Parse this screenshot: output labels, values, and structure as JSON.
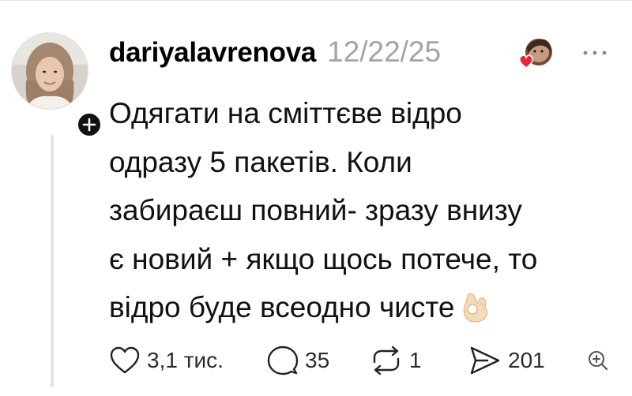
{
  "post": {
    "username": "dariyalavrenova",
    "timestamp": "12/22/25",
    "text_lines": [
      "Одягати на сміттєве відро",
      "одразу 5 пакетів. Коли",
      "забираєш повний- зразу внизу",
      "є новий + якщо щось потече, то",
      "відро буде всеодно чисте"
    ],
    "emoji": "ok-hand"
  },
  "actions": {
    "likes": "3,1 тис.",
    "comments": "35",
    "reposts": "1",
    "shares": "201"
  },
  "icons": {
    "like": "heart-icon",
    "comment": "comment-bubble-icon",
    "repost": "repost-icon",
    "share": "send-icon",
    "more": "more-dots-icon",
    "follow": "plus-icon",
    "quote": "quote-icon"
  },
  "colors": {
    "text": "#111111",
    "muted": "#a3a3a3",
    "heart_badge": "#e8263b",
    "thread_line": "#e4e4e4"
  }
}
